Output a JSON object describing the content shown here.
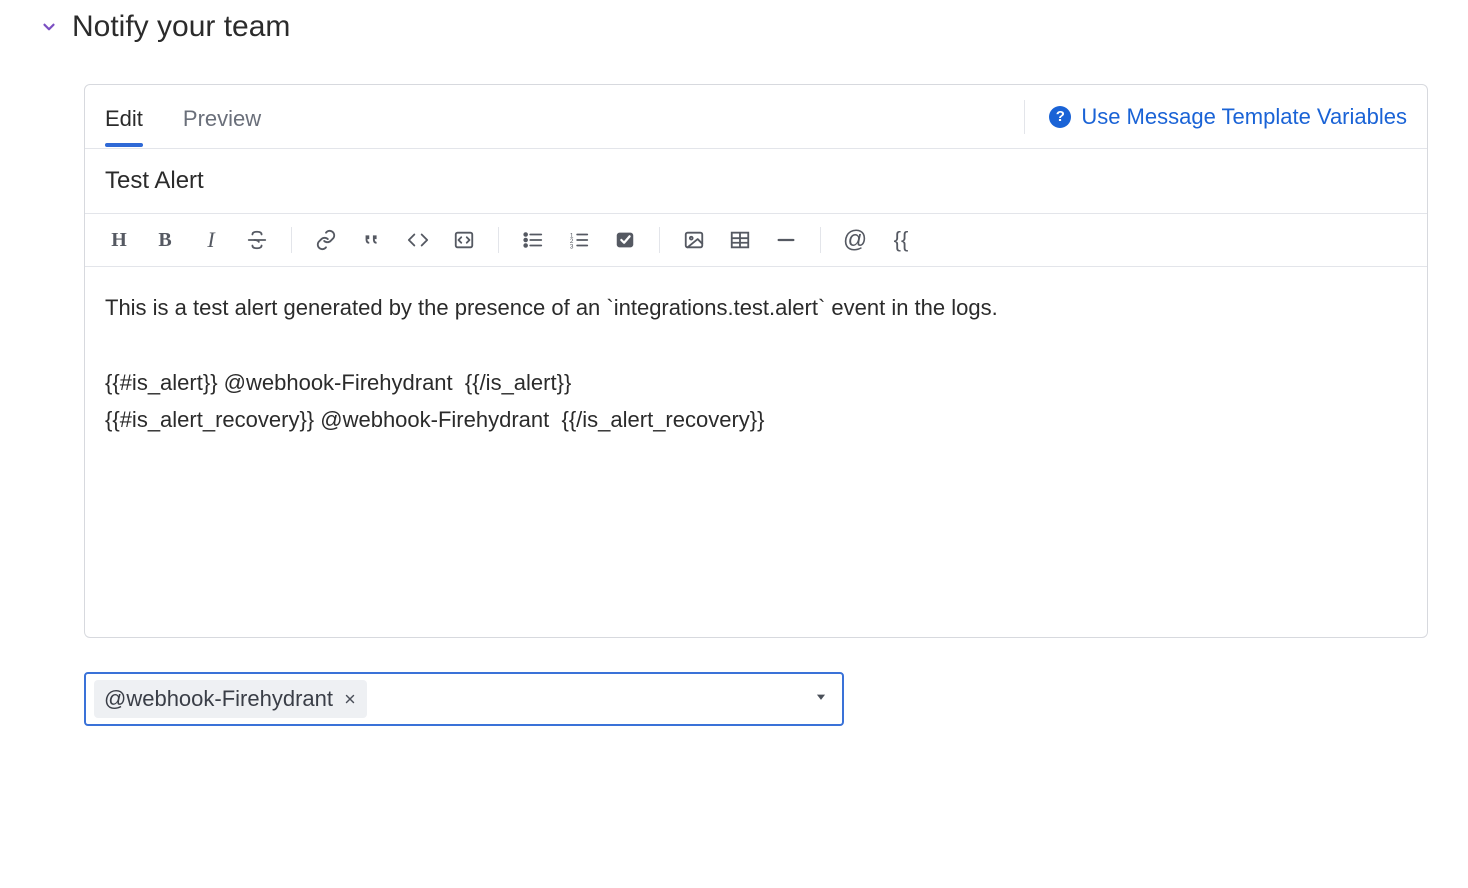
{
  "section": {
    "title": "Notify your team"
  },
  "tabs": {
    "edit": "Edit",
    "preview": "Preview",
    "active": "edit"
  },
  "template_link": {
    "label": "Use Message Template Variables"
  },
  "message": {
    "title": "Test Alert",
    "body": "This is a test alert generated by the presence of an `integrations.test.alert` event in the logs.\n\n{{#is_alert}} @webhook-Firehydrant  {{/is_alert}}\n{{#is_alert_recovery}} @webhook-Firehydrant  {{/is_alert_recovery}}"
  },
  "toolbar": {
    "heading": "H",
    "bold": "B",
    "italic": "I",
    "strike": "S",
    "link": "link",
    "quote": "quote",
    "code": "code",
    "codeblock": "code-block",
    "ul": "unordered-list",
    "ol": "ordered-list",
    "task": "task-list",
    "image": "image",
    "table": "table",
    "hr": "horizontal-rule",
    "mention": "@",
    "template": "{{"
  },
  "notify": {
    "chips": [
      {
        "label": "@webhook-Firehydrant"
      }
    ]
  }
}
